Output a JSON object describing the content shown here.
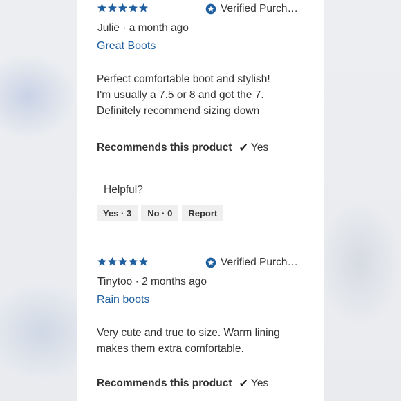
{
  "colors": {
    "star": "#1f5fa0",
    "link": "#1f5fa0",
    "verified_badge": "#1f5fa0",
    "button_bg": "#efefef"
  },
  "reviews": [
    {
      "rating": 5,
      "verified_label": "Verified Purchaser",
      "author": "Julie",
      "separator": "·",
      "date": "a month ago",
      "title": "Great Boots",
      "body_lines": [
        "Perfect comfortable boot and stylish!",
        "I'm usually a 7.5 or 8 and got the 7.",
        "Definitely recommend sizing down"
      ],
      "recommends_label": "Recommends this product",
      "recommends_value": "Yes",
      "helpful_label": "Helpful?",
      "yes_button": "Yes · 3",
      "no_button": "No · 0",
      "report_button": "Report"
    },
    {
      "rating": 5,
      "verified_label": "Verified Purchaser",
      "author": "Tinytoo",
      "separator": "·",
      "date": "2 months ago",
      "title": "Rain boots",
      "body_lines": [
        "Very cute and true to size. Warm lining",
        "makes them extra comfortable."
      ],
      "recommends_label": "Recommends this product",
      "recommends_value": "Yes"
    }
  ]
}
